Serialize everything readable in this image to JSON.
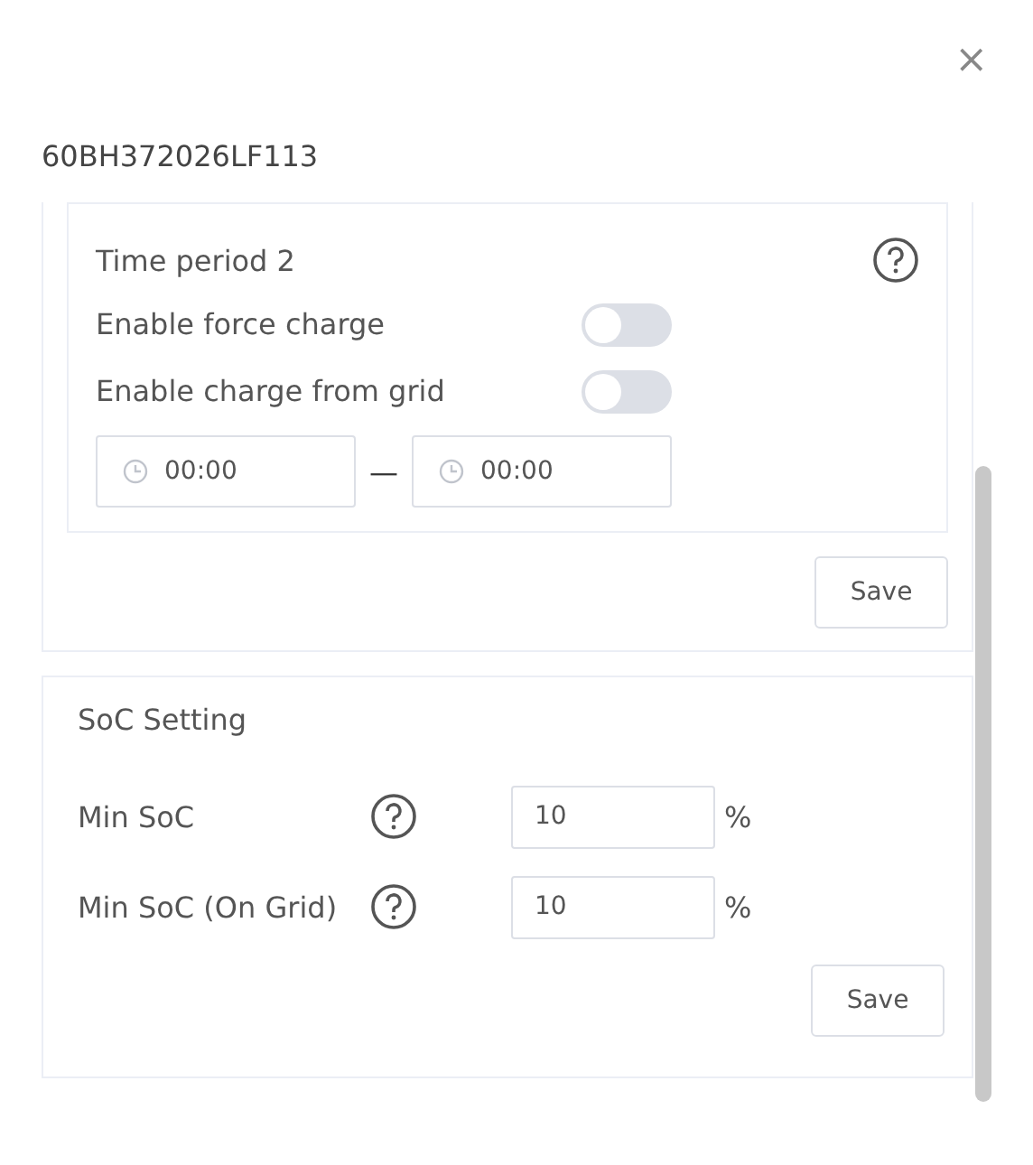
{
  "dialog": {
    "title": "60BH372026LF113",
    "close": "×"
  },
  "time_period": {
    "title": "Time period 2",
    "switches": [
      {
        "label": "Enable force charge",
        "on": false
      },
      {
        "label": "Enable charge from grid",
        "on": false
      }
    ],
    "start_time": "00:00",
    "separator": "—",
    "end_time": "00:00",
    "save": "Save"
  },
  "soc": {
    "title": "SoC Setting",
    "fields": [
      {
        "label": "Min SoC",
        "value": "10",
        "unit": "%"
      },
      {
        "label": "Min SoC (On Grid)",
        "value": "10",
        "unit": "%"
      }
    ],
    "save": "Save"
  }
}
